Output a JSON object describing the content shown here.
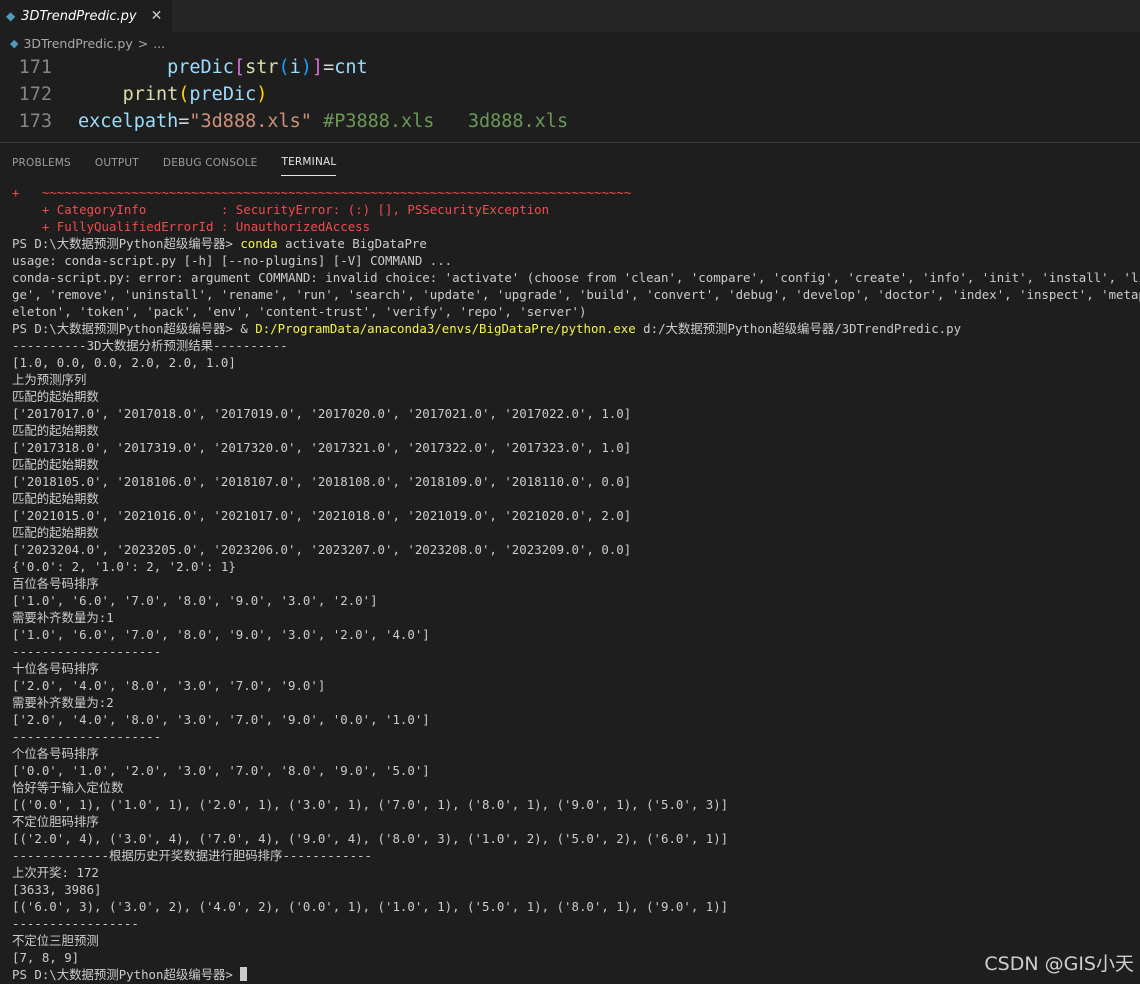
{
  "tabbar": {
    "tab_title": "3DTrendPredic.py",
    "close_glyph": "✕"
  },
  "breadcrumb": {
    "file": "3DTrendPredic.py",
    "sep": ">",
    "more": "..."
  },
  "editor": {
    "lines": [
      {
        "num": "171",
        "indent": "        ",
        "tokens": [
          {
            "t": "preDic",
            "c": "var"
          },
          {
            "t": "[",
            "c": "br1"
          },
          {
            "t": "str",
            "c": "fn"
          },
          {
            "t": "(",
            "c": "br2"
          },
          {
            "t": "i",
            "c": "var"
          },
          {
            "t": ")",
            "c": "br2"
          },
          {
            "t": "]",
            "c": "br1"
          },
          {
            "t": "=",
            "c": "plain"
          },
          {
            "t": "cnt",
            "c": "var"
          }
        ]
      },
      {
        "num": "172",
        "indent": "    ",
        "tokens": [
          {
            "t": "print",
            "c": "fn"
          },
          {
            "t": "(",
            "c": "br3"
          },
          {
            "t": "preDic",
            "c": "var"
          },
          {
            "t": ")",
            "c": "br3"
          }
        ]
      },
      {
        "num": "173",
        "indent": "",
        "tokens": [
          {
            "t": "excelpath",
            "c": "var"
          },
          {
            "t": "=",
            "c": "plain"
          },
          {
            "t": "\"3d888.xls\"",
            "c": "str"
          },
          {
            "t": " ",
            "c": "plain"
          },
          {
            "t": "#P3888.xls   3d888.xls",
            "c": "cmt"
          }
        ]
      }
    ]
  },
  "panel": {
    "tabs": [
      "PROBLEMS",
      "OUTPUT",
      "DEBUG CONSOLE",
      "TERMINAL"
    ],
    "active": "TERMINAL"
  },
  "terminal": {
    "lines": [
      [
        {
          "t": "+   ~~~~~~~~~~~~~~~~~~~~~~~~~~~~~~~~~~~~~~~~~~~~~~~~~~~~~~~~~~~~~~~~~~~~~~~~~~~~~~~",
          "c": "err"
        }
      ],
      [
        {
          "t": "    + CategoryInfo          : SecurityError: (:) [], PSSecurityException",
          "c": "err"
        }
      ],
      [
        {
          "t": "    + FullyQualifiedErrorId : UnauthorizedAccess",
          "c": "err"
        }
      ],
      [
        {
          "t": "PS D:\\大数据预测Python超级编号器> ",
          "c": "plain"
        },
        {
          "t": "conda",
          "c": "yel"
        },
        {
          "t": " activate BigDataPre",
          "c": "plain"
        }
      ],
      [
        {
          "t": "usage: conda-script.py [-h] [--no-plugins] [-V] COMMAND ...",
          "c": "plain"
        }
      ],
      [
        {
          "t": "conda-script.py: error: argument COMMAND: invalid choice: 'activate' (choose from 'clean', 'compare', 'config', 'create', 'info', 'init', 'install', 'list', 'notice', 'packa",
          "c": "plain"
        }
      ],
      [
        {
          "t": "ge', 'remove', 'uninstall', 'rename', 'run', 'search', 'update', 'upgrade', 'build', 'convert', 'debug', 'develop', 'doctor', 'index', 'inspect', 'metapackage', 'render', 'sk",
          "c": "plain"
        }
      ],
      [
        {
          "t": "eleton', 'token', 'pack', 'env', 'content-trust', 'verify', 'repo', 'server')",
          "c": "plain"
        }
      ],
      [
        {
          "t": "PS D:\\大数据预测Python超级编号器> & ",
          "c": "plain"
        },
        {
          "t": "D:/ProgramData/anaconda3/envs/BigDataPre/python.exe",
          "c": "yel"
        },
        {
          "t": " d:/大数据预测Python超级编号器/3DTrendPredic.py",
          "c": "plain"
        }
      ],
      [
        {
          "t": "----------3D大数据分析预测结果----------",
          "c": "plain"
        }
      ],
      [
        {
          "t": "[1.0, 0.0, 0.0, 2.0, 2.0, 1.0]",
          "c": "plain"
        }
      ],
      [
        {
          "t": "上为预测序列",
          "c": "plain"
        }
      ],
      [
        {
          "t": "匹配的起始期数",
          "c": "plain"
        }
      ],
      [
        {
          "t": "['2017017.0', '2017018.0', '2017019.0', '2017020.0', '2017021.0', '2017022.0', 1.0]",
          "c": "plain"
        }
      ],
      [
        {
          "t": "匹配的起始期数",
          "c": "plain"
        }
      ],
      [
        {
          "t": "['2017318.0', '2017319.0', '2017320.0', '2017321.0', '2017322.0', '2017323.0', 1.0]",
          "c": "plain"
        }
      ],
      [
        {
          "t": "匹配的起始期数",
          "c": "plain"
        }
      ],
      [
        {
          "t": "['2018105.0', '2018106.0', '2018107.0', '2018108.0', '2018109.0', '2018110.0', 0.0]",
          "c": "plain"
        }
      ],
      [
        {
          "t": "匹配的起始期数",
          "c": "plain"
        }
      ],
      [
        {
          "t": "['2021015.0', '2021016.0', '2021017.0', '2021018.0', '2021019.0', '2021020.0', 2.0]",
          "c": "plain"
        }
      ],
      [
        {
          "t": "匹配的起始期数",
          "c": "plain"
        }
      ],
      [
        {
          "t": "['2023204.0', '2023205.0', '2023206.0', '2023207.0', '2023208.0', '2023209.0', 0.0]",
          "c": "plain"
        }
      ],
      [
        {
          "t": "{'0.0': 2, '1.0': 2, '2.0': 1}",
          "c": "plain"
        }
      ],
      [
        {
          "t": "百位各号码排序",
          "c": "plain"
        }
      ],
      [
        {
          "t": "['1.0', '6.0', '7.0', '8.0', '9.0', '3.0', '2.0']",
          "c": "plain"
        }
      ],
      [
        {
          "t": "需要补齐数量为:1",
          "c": "plain"
        }
      ],
      [
        {
          "t": "['1.0', '6.0', '7.0', '8.0', '9.0', '3.0', '2.0', '4.0']",
          "c": "plain"
        }
      ],
      [
        {
          "t": "--------------------",
          "c": "plain"
        }
      ],
      [
        {
          "t": "十位各号码排序",
          "c": "plain"
        }
      ],
      [
        {
          "t": "['2.0', '4.0', '8.0', '3.0', '7.0', '9.0']",
          "c": "plain"
        }
      ],
      [
        {
          "t": "需要补齐数量为:2",
          "c": "plain"
        }
      ],
      [
        {
          "t": "['2.0', '4.0', '8.0', '3.0', '7.0', '9.0', '0.0', '1.0']",
          "c": "plain"
        }
      ],
      [
        {
          "t": "--------------------",
          "c": "plain"
        }
      ],
      [
        {
          "t": "个位各号码排序",
          "c": "plain"
        }
      ],
      [
        {
          "t": "['0.0', '1.0', '2.0', '3.0', '7.0', '8.0', '9.0', '5.0']",
          "c": "plain"
        }
      ],
      [
        {
          "t": "恰好等于输入定位数",
          "c": "plain"
        }
      ],
      [
        {
          "t": "[('0.0', 1), ('1.0', 1), ('2.0', 1), ('3.0', 1), ('7.0', 1), ('8.0', 1), ('9.0', 1), ('5.0', 3)]",
          "c": "plain"
        }
      ],
      [
        {
          "t": "不定位胆码排序",
          "c": "plain"
        }
      ],
      [
        {
          "t": "[('2.0', 4), ('3.0', 4), ('7.0', 4), ('9.0', 4), ('8.0', 3), ('1.0', 2), ('5.0', 2), ('6.0', 1)]",
          "c": "plain"
        }
      ],
      [
        {
          "t": "-------------根据历史开奖数据进行胆码排序------------",
          "c": "plain"
        }
      ],
      [
        {
          "t": "上次开奖: 172",
          "c": "plain"
        }
      ],
      [
        {
          "t": "[3633, 3986]",
          "c": "plain"
        }
      ],
      [
        {
          "t": "[('6.0', 3), ('3.0', 2), ('4.0', 2), ('0.0', 1), ('1.0', 1), ('5.0', 1), ('8.0', 1), ('9.0', 1)]",
          "c": "plain"
        }
      ],
      [
        {
          "t": "-----------------",
          "c": "plain"
        }
      ],
      [
        {
          "t": "不定位三胆预测",
          "c": "plain"
        }
      ],
      [
        {
          "t": "[7, 8, 9]",
          "c": "plain"
        }
      ],
      [
        {
          "t": "PS D:\\大数据预测Python超级编号器> ",
          "c": "plain"
        }
      ]
    ]
  },
  "watermark": "CSDN @GIS小天"
}
